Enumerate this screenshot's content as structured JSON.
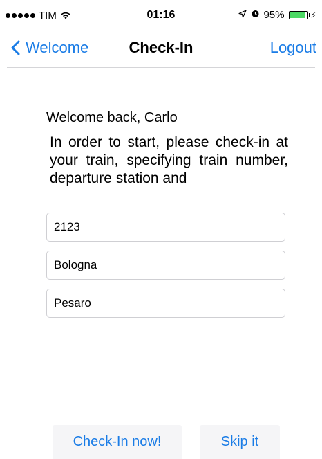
{
  "status_bar": {
    "carrier": "TIM",
    "time": "01:16",
    "battery_percent": "95%",
    "battery_level": 0.95,
    "icons": [
      "signal-dots",
      "wifi-icon",
      "location-arrow-icon",
      "alarm-icon",
      "battery-icon",
      "charging-bolt-icon"
    ]
  },
  "nav": {
    "back_label": "Welcome",
    "title": "Check-In",
    "right_label": "Logout"
  },
  "content": {
    "welcome_text": "Welcome back,  Carlo",
    "instructions": "In order to start, please check-in at your train, specifying train number, departure station and"
  },
  "form": {
    "train_number": "2123",
    "departure_station": "Bologna",
    "arrival_station": "Pesaro"
  },
  "buttons": {
    "checkin_label": "Check-In now!",
    "skip_label": "Skip it"
  },
  "colors": {
    "accent": "#1a7ce6",
    "battery": "#4cd964",
    "button_bg": "#f5f5f7"
  }
}
